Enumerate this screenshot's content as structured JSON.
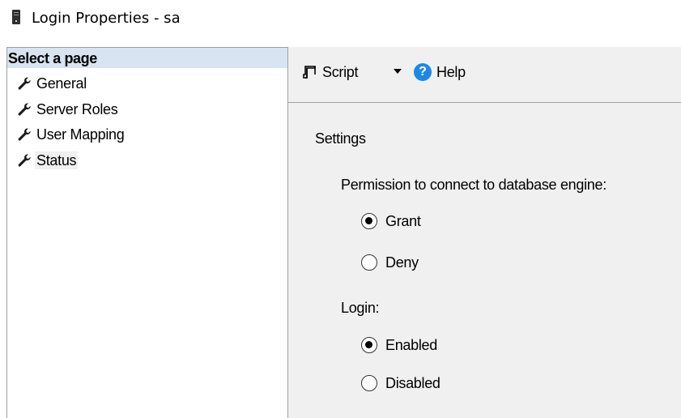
{
  "window": {
    "title": "Login Properties - sa",
    "icon": "server-icon"
  },
  "left_pane": {
    "header": "Select a page",
    "items": [
      {
        "label": "General",
        "icon": "wrench-icon"
      },
      {
        "label": "Server Roles",
        "icon": "wrench-icon"
      },
      {
        "label": "User Mapping",
        "icon": "wrench-icon"
      },
      {
        "label": "Status",
        "icon": "wrench-icon",
        "selected": true
      }
    ]
  },
  "toolbar": {
    "script_label": "Script",
    "help_label": "Help",
    "help_icon_glyph": "?"
  },
  "settings": {
    "section_label": "Settings",
    "permission": {
      "label": "Permission to connect to database engine:",
      "options": [
        {
          "label": "Grant",
          "checked": true
        },
        {
          "label": "Deny",
          "checked": false
        }
      ]
    },
    "login": {
      "label": "Login:",
      "options": [
        {
          "label": "Enabled",
          "checked": true
        },
        {
          "label": "Disabled",
          "checked": false
        }
      ]
    }
  },
  "colors": {
    "header_bg": "#d8e4f1",
    "pane_bg": "#f0f0f0",
    "help_blue": "#1e88e5"
  }
}
